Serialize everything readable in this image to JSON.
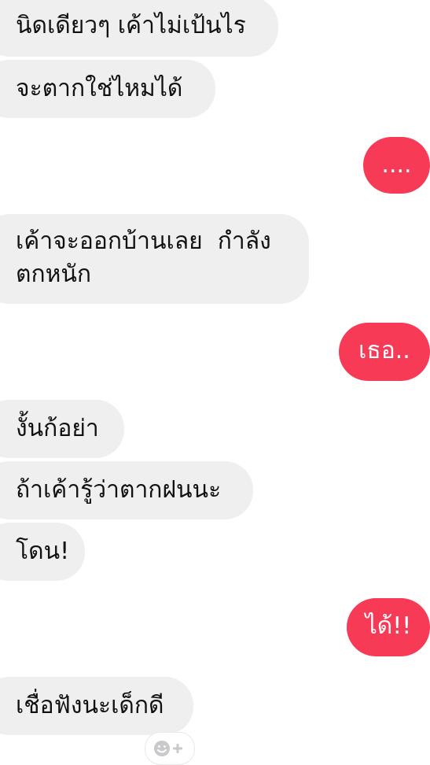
{
  "conversation": {
    "messages": [
      {
        "side": "in",
        "text": "นิดเดียวๆ เค้าไม่เป้นไร"
      },
      {
        "side": "in",
        "text": "จะตากใช่ไหมได้"
      },
      {
        "side": "out",
        "text": "...."
      },
      {
        "side": "in",
        "text": "เค้าจะออกบ้านเลย  กำลัง\nตกหนัก"
      },
      {
        "side": "out",
        "text": "เธอ.."
      },
      {
        "side": "in",
        "text": "งั้นก้อย่า"
      },
      {
        "side": "in",
        "text": "ถ้าเค้ารู้ว่าตากฝนนะ"
      },
      {
        "side": "in",
        "text": "โดน!"
      },
      {
        "side": "out",
        "text": "ได้!!"
      },
      {
        "side": "in",
        "text": "เชื่อฟังนะเด็กดี"
      }
    ]
  },
  "reaction": {
    "icon": "add-reaction-icon"
  },
  "colors": {
    "incoming_bubble": "#efeff0",
    "outgoing_bubble": "#f73a56",
    "incoming_text": "#111111",
    "outgoing_text": "#ffffff"
  }
}
